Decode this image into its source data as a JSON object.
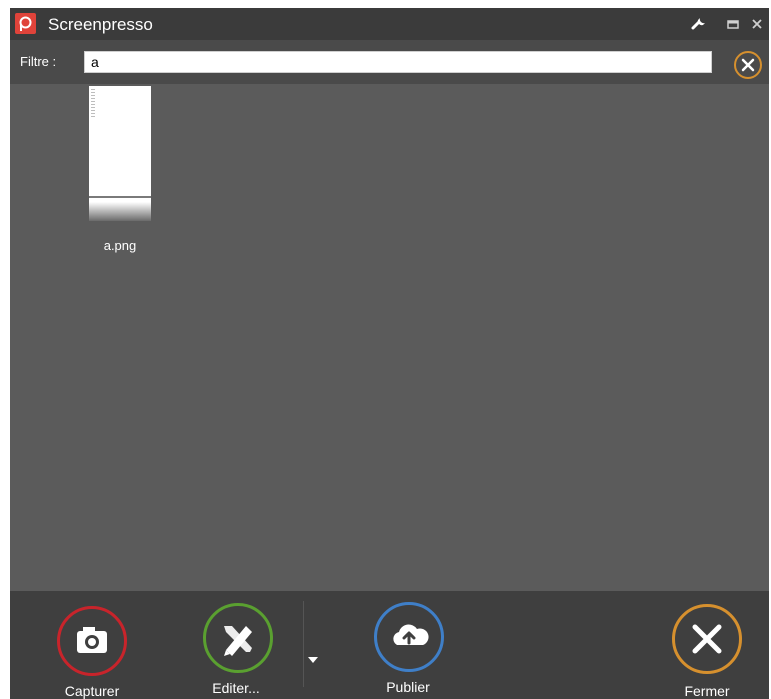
{
  "window": {
    "title": "Screenpresso",
    "logo": "screenpresso-logo-icon"
  },
  "titlebar_buttons": [
    "wrench-icon",
    "maximize-icon",
    "close-icon"
  ],
  "filter": {
    "label": "Filtre :",
    "value": "a",
    "clear_icon": "clear-circle-icon"
  },
  "files": [
    {
      "name": "a.png"
    }
  ],
  "actions": {
    "capture": {
      "label": "Capturer",
      "icon": "camera-icon",
      "color": "#c8242b"
    },
    "edit": {
      "label": "Editer...",
      "icon": "edit-tools-icon",
      "color": "#5aa030"
    },
    "dropdown": {
      "icon": "dropdown-arrow-icon"
    },
    "publish": {
      "label": "Publier",
      "icon": "cloud-upload-icon",
      "color": "#3f7fc8"
    },
    "close": {
      "label": "Fermer",
      "icon": "close-x-icon",
      "color": "#d6902e"
    }
  },
  "colors": {
    "titlebar": "#3b3b3b",
    "content": "#5b5b5b",
    "bottombar": "#3f3f3f"
  }
}
